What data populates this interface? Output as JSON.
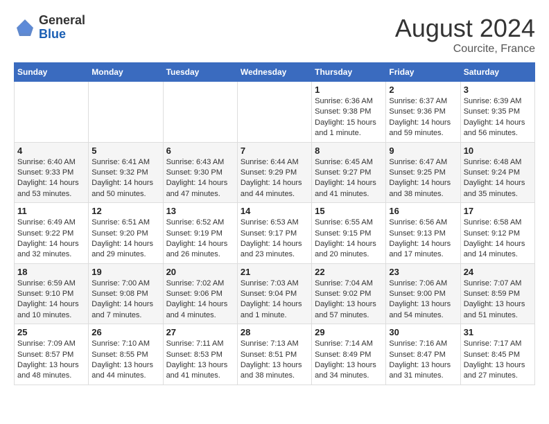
{
  "logo": {
    "general": "General",
    "blue": "Blue"
  },
  "title": "August 2024",
  "subtitle": "Courcite, France",
  "days_of_week": [
    "Sunday",
    "Monday",
    "Tuesday",
    "Wednesday",
    "Thursday",
    "Friday",
    "Saturday"
  ],
  "weeks": [
    [
      {
        "day": "",
        "info": ""
      },
      {
        "day": "",
        "info": ""
      },
      {
        "day": "",
        "info": ""
      },
      {
        "day": "",
        "info": ""
      },
      {
        "day": "1",
        "info": "Sunrise: 6:36 AM\nSunset: 9:38 PM\nDaylight: 15 hours and 1 minute."
      },
      {
        "day": "2",
        "info": "Sunrise: 6:37 AM\nSunset: 9:36 PM\nDaylight: 14 hours and 59 minutes."
      },
      {
        "day": "3",
        "info": "Sunrise: 6:39 AM\nSunset: 9:35 PM\nDaylight: 14 hours and 56 minutes."
      }
    ],
    [
      {
        "day": "4",
        "info": "Sunrise: 6:40 AM\nSunset: 9:33 PM\nDaylight: 14 hours and 53 minutes."
      },
      {
        "day": "5",
        "info": "Sunrise: 6:41 AM\nSunset: 9:32 PM\nDaylight: 14 hours and 50 minutes."
      },
      {
        "day": "6",
        "info": "Sunrise: 6:43 AM\nSunset: 9:30 PM\nDaylight: 14 hours and 47 minutes."
      },
      {
        "day": "7",
        "info": "Sunrise: 6:44 AM\nSunset: 9:29 PM\nDaylight: 14 hours and 44 minutes."
      },
      {
        "day": "8",
        "info": "Sunrise: 6:45 AM\nSunset: 9:27 PM\nDaylight: 14 hours and 41 minutes."
      },
      {
        "day": "9",
        "info": "Sunrise: 6:47 AM\nSunset: 9:25 PM\nDaylight: 14 hours and 38 minutes."
      },
      {
        "day": "10",
        "info": "Sunrise: 6:48 AM\nSunset: 9:24 PM\nDaylight: 14 hours and 35 minutes."
      }
    ],
    [
      {
        "day": "11",
        "info": "Sunrise: 6:49 AM\nSunset: 9:22 PM\nDaylight: 14 hours and 32 minutes."
      },
      {
        "day": "12",
        "info": "Sunrise: 6:51 AM\nSunset: 9:20 PM\nDaylight: 14 hours and 29 minutes."
      },
      {
        "day": "13",
        "info": "Sunrise: 6:52 AM\nSunset: 9:19 PM\nDaylight: 14 hours and 26 minutes."
      },
      {
        "day": "14",
        "info": "Sunrise: 6:53 AM\nSunset: 9:17 PM\nDaylight: 14 hours and 23 minutes."
      },
      {
        "day": "15",
        "info": "Sunrise: 6:55 AM\nSunset: 9:15 PM\nDaylight: 14 hours and 20 minutes."
      },
      {
        "day": "16",
        "info": "Sunrise: 6:56 AM\nSunset: 9:13 PM\nDaylight: 14 hours and 17 minutes."
      },
      {
        "day": "17",
        "info": "Sunrise: 6:58 AM\nSunset: 9:12 PM\nDaylight: 14 hours and 14 minutes."
      }
    ],
    [
      {
        "day": "18",
        "info": "Sunrise: 6:59 AM\nSunset: 9:10 PM\nDaylight: 14 hours and 10 minutes."
      },
      {
        "day": "19",
        "info": "Sunrise: 7:00 AM\nSunset: 9:08 PM\nDaylight: 14 hours and 7 minutes."
      },
      {
        "day": "20",
        "info": "Sunrise: 7:02 AM\nSunset: 9:06 PM\nDaylight: 14 hours and 4 minutes."
      },
      {
        "day": "21",
        "info": "Sunrise: 7:03 AM\nSunset: 9:04 PM\nDaylight: 14 hours and 1 minute."
      },
      {
        "day": "22",
        "info": "Sunrise: 7:04 AM\nSunset: 9:02 PM\nDaylight: 13 hours and 57 minutes."
      },
      {
        "day": "23",
        "info": "Sunrise: 7:06 AM\nSunset: 9:00 PM\nDaylight: 13 hours and 54 minutes."
      },
      {
        "day": "24",
        "info": "Sunrise: 7:07 AM\nSunset: 8:59 PM\nDaylight: 13 hours and 51 minutes."
      }
    ],
    [
      {
        "day": "25",
        "info": "Sunrise: 7:09 AM\nSunset: 8:57 PM\nDaylight: 13 hours and 48 minutes."
      },
      {
        "day": "26",
        "info": "Sunrise: 7:10 AM\nSunset: 8:55 PM\nDaylight: 13 hours and 44 minutes."
      },
      {
        "day": "27",
        "info": "Sunrise: 7:11 AM\nSunset: 8:53 PM\nDaylight: 13 hours and 41 minutes."
      },
      {
        "day": "28",
        "info": "Sunrise: 7:13 AM\nSunset: 8:51 PM\nDaylight: 13 hours and 38 minutes."
      },
      {
        "day": "29",
        "info": "Sunrise: 7:14 AM\nSunset: 8:49 PM\nDaylight: 13 hours and 34 minutes."
      },
      {
        "day": "30",
        "info": "Sunrise: 7:16 AM\nSunset: 8:47 PM\nDaylight: 13 hours and 31 minutes."
      },
      {
        "day": "31",
        "info": "Sunrise: 7:17 AM\nSunset: 8:45 PM\nDaylight: 13 hours and 27 minutes."
      }
    ]
  ]
}
